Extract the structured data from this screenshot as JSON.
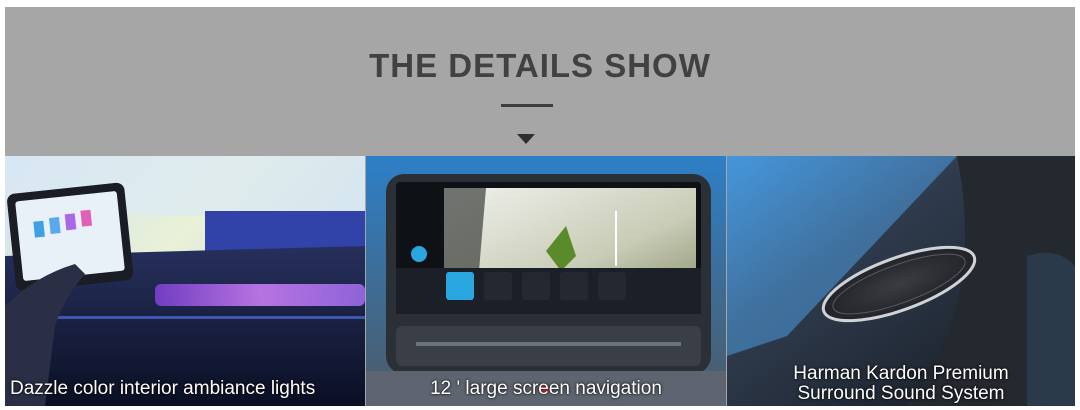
{
  "section": {
    "title": "THE DETAILS SHOW"
  },
  "panels": [
    {
      "caption": "Dazzle color interior ambiance lights"
    },
    {
      "caption": "12 ' large screen navigation"
    },
    {
      "caption_line1": "Harman Kardon Premium",
      "caption_line2": "Surround Sound System"
    }
  ],
  "colors": {
    "header_background": "#a6a6a6",
    "title_text": "#414141",
    "caption_text": "#ffffff"
  }
}
